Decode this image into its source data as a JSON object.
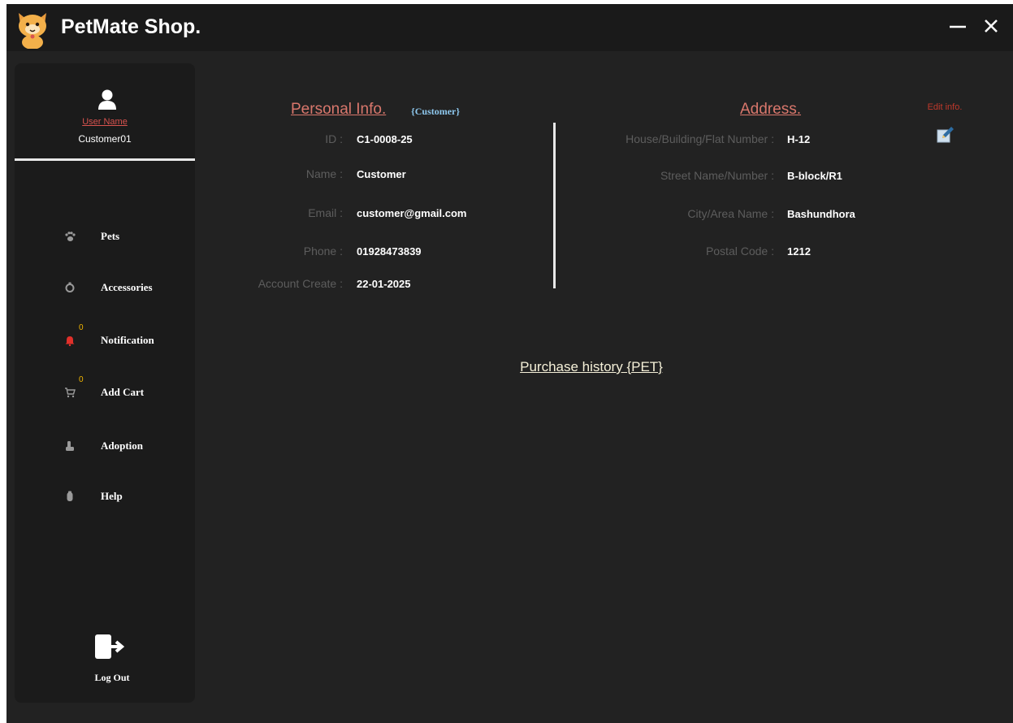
{
  "app": {
    "title": "PetMate Shop."
  },
  "user": {
    "label": "User Name",
    "name": "Customer01"
  },
  "sidebar": {
    "items": [
      {
        "label": "Pets",
        "icon": "paw-icon"
      },
      {
        "label": "Accessories",
        "icon": "ring-icon"
      },
      {
        "label": "Notification",
        "icon": "bell-icon",
        "badge": "0"
      },
      {
        "label": "Add Cart",
        "icon": "cart-icon",
        "badge": "0"
      },
      {
        "label": "Adoption",
        "icon": "adoption-icon"
      },
      {
        "label": "Help",
        "icon": "help-icon"
      }
    ],
    "logout": "Log Out"
  },
  "personal": {
    "title": "Personal Info.",
    "tag": "{Customer}",
    "fields": [
      {
        "label": "ID :",
        "value": "C1-0008-25"
      },
      {
        "label": "Name :",
        "value": "Customer"
      },
      {
        "label": "Email :",
        "value": "customer@gmail.com"
      },
      {
        "label": "Phone :",
        "value": "01928473839"
      },
      {
        "label": "Account Create :",
        "value": "22-01-2025"
      }
    ]
  },
  "address": {
    "title": "Address.",
    "fields": [
      {
        "label": "House/Building/Flat Number :",
        "value": "H-12"
      },
      {
        "label": "Street Name/Number :",
        "value": "B-block/R1"
      },
      {
        "label": "City/Area Name :",
        "value": "Bashundhora"
      },
      {
        "label": "Postal Code :",
        "value": "1212"
      }
    ]
  },
  "edit": {
    "label": "Edit info."
  },
  "purchase": {
    "label": "Purchase history {PET}"
  },
  "colors": {
    "background": "#222222",
    "sidebar": "#1b1b1b",
    "accent": "#d9776c",
    "tag": "#8ec8ee",
    "badge": "#f0b400"
  }
}
